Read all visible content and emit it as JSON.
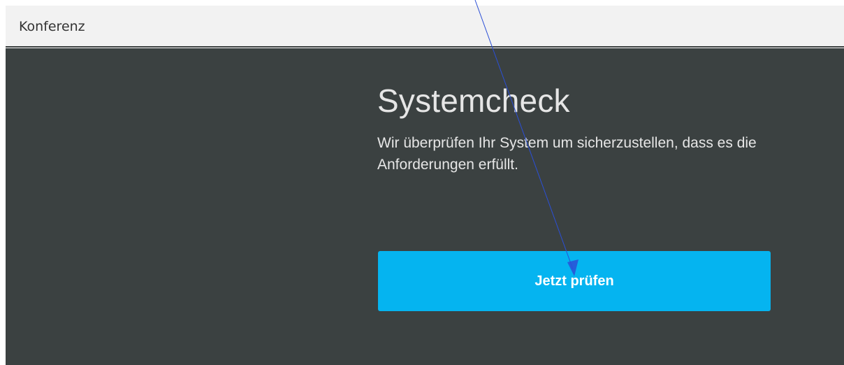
{
  "header": {
    "title": "Konferenz"
  },
  "main": {
    "heading": "Systemcheck",
    "description": "Wir überprüfen Ihr System um sicherzustellen, dass es die Anforderungen erfüllt.",
    "check_button_label": "Jetzt prüfen"
  },
  "colors": {
    "header_background": "#f2f2f2",
    "page_background": "#3b4141",
    "button_accent": "#05b4f0",
    "annotation_arrow": "#2b4fd6"
  },
  "icons": {
    "annotation": "pointer-arrow-icon"
  }
}
